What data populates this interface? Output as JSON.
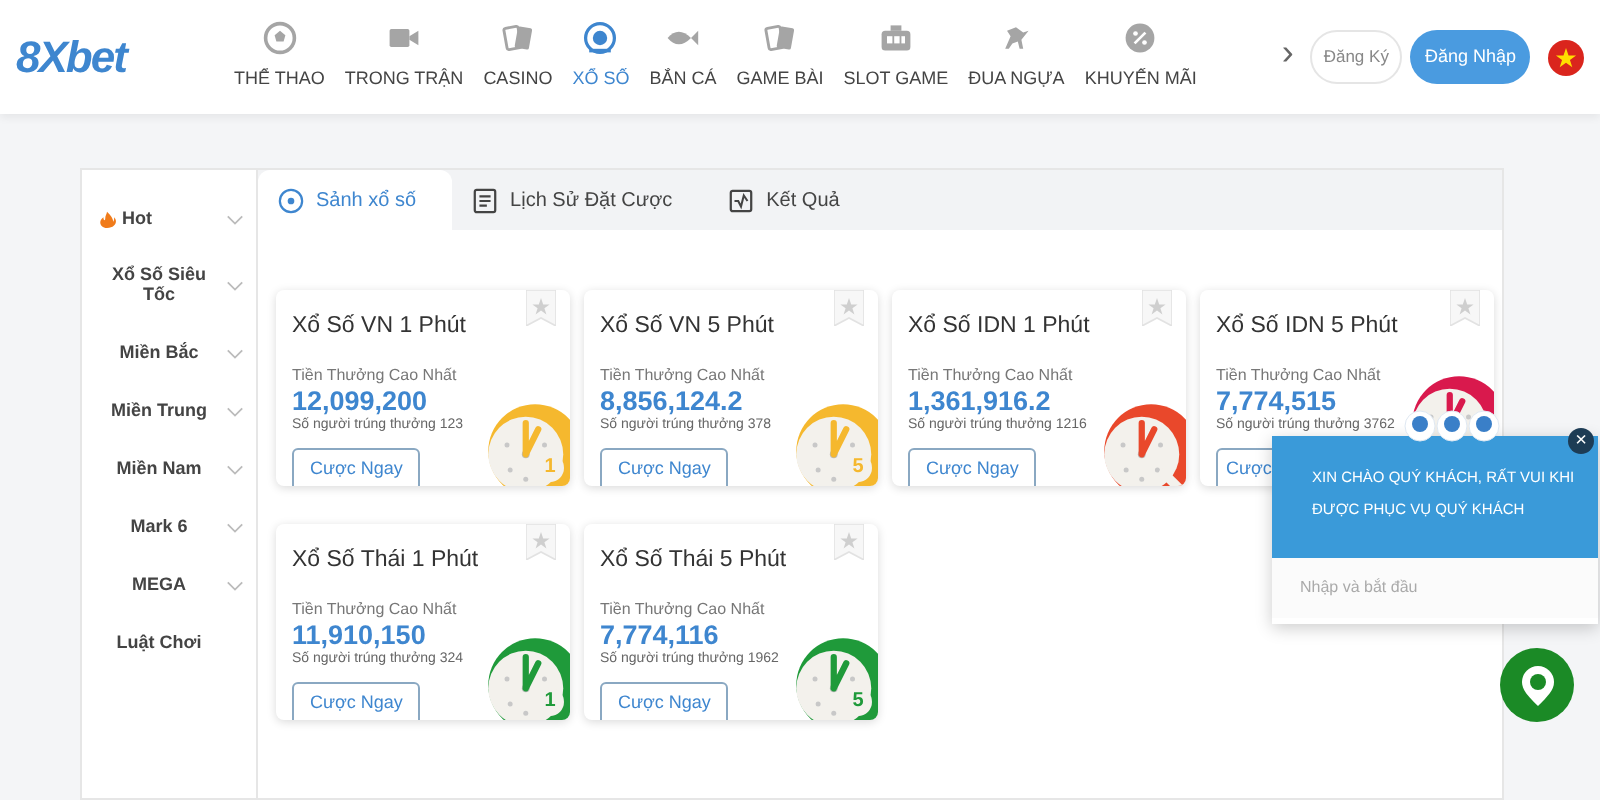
{
  "header": {
    "logo": "8Xbet",
    "nav": [
      {
        "label": "THỂ THAO",
        "selected": false
      },
      {
        "label": "TRONG TRẬN",
        "selected": false
      },
      {
        "label": "CASINO",
        "selected": false
      },
      {
        "label": "XỔ SỐ",
        "selected": true
      },
      {
        "label": "BẮN CÁ",
        "selected": false
      },
      {
        "label": "GAME BÀI",
        "selected": false
      },
      {
        "label": "SLOT GAME",
        "selected": false
      },
      {
        "label": "ĐUA NGỰA",
        "selected": false
      },
      {
        "label": "KHUYẾN MÃI",
        "selected": false
      }
    ],
    "next": "›",
    "register": "Đăng Ký",
    "login": "Đăng Nhập"
  },
  "sidebar": [
    {
      "label": "Hot",
      "hot": true,
      "expandable": true
    },
    {
      "label": "Xổ Số Siêu Tốc",
      "hot": false,
      "expandable": true
    },
    {
      "label": "Miền Bắc",
      "hot": false,
      "expandable": true
    },
    {
      "label": "Miền Trung",
      "hot": false,
      "expandable": true
    },
    {
      "label": "Miền Nam",
      "hot": false,
      "expandable": true
    },
    {
      "label": "Mark 6",
      "hot": false,
      "expandable": true
    },
    {
      "label": "MEGA",
      "hot": false,
      "expandable": true
    },
    {
      "label": "Luật Chơi",
      "hot": false,
      "expandable": false
    }
  ],
  "tabs": [
    {
      "label": "Sảnh xổ số",
      "selected": true
    },
    {
      "label": "Lịch Sử Đặt Cược",
      "selected": false
    },
    {
      "label": "Kết Quả",
      "selected": false
    }
  ],
  "games": [
    {
      "title": "Xổ Số VN 1 Phút",
      "prize_label": "Tiền Thưởng Cao Nhất",
      "prize": "12,099,200",
      "winners": "Số người trúng thưởng 123",
      "button": "Cược Ngay",
      "favorite": false,
      "color": "#f5b82e",
      "badge": "1"
    },
    {
      "title": "Xổ Số VN 5 Phút",
      "prize_label": "Tiền Thưởng Cao Nhất",
      "prize": "8,856,124.2",
      "winners": "Số người trúng thưởng 378",
      "button": "Cược Ngay",
      "favorite": false,
      "color": "#f5b82e",
      "badge": "5"
    },
    {
      "title": "Xổ Số IDN 1 Phút",
      "prize_label": "Tiền Thưởng Cao Nhất",
      "prize": "1,361,916.2",
      "winners": "Số người trúng thưởng 1216",
      "button": "Cược Ngay",
      "favorite": false,
      "color": "#e9482b"
    },
    {
      "title": "Xổ Số IDN 5 Phút",
      "prize_label": "Tiền Thưởng Cao Nhất",
      "prize": "7,774,515",
      "winners": "Số người trúng thưởng 3762",
      "button": "Cược",
      "favorite": false,
      "color": "#d9194d"
    },
    {
      "title": "Xổ Số Thái 1 Phút",
      "prize_label": "Tiền Thưởng Cao Nhất",
      "prize": "11,910,150",
      "winners": "Số người trúng thưởng 324",
      "button": "Cược Ngay",
      "favorite": false,
      "color": "#1f9a3a",
      "badge": "1"
    },
    {
      "title": "Xổ Số Thái 5 Phút",
      "prize_label": "Tiền Thưởng Cao Nhất",
      "prize": "7,774,116",
      "winners": "Số người trúng thưởng 1962",
      "button": "Cược Ngay",
      "favorite": false,
      "color": "#1f9a3a",
      "badge": "5"
    }
  ],
  "chat": {
    "message": "XIN CHÀO QUÝ KHÁCH, RẤT VUI KHI ĐƯỢC PHỤC VỤ QUÝ KHÁCH",
    "placeholder": "Nhập và bắt đầu",
    "close": "×"
  }
}
